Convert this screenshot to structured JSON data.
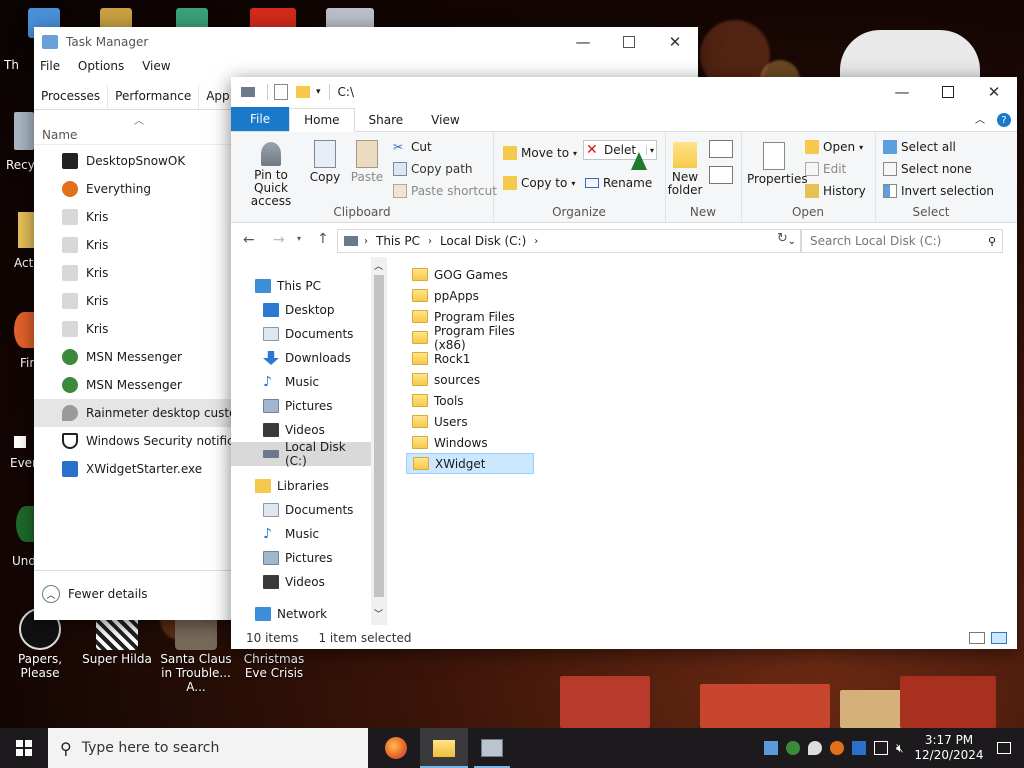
{
  "desktop": {
    "icons": [
      {
        "label": "Th"
      },
      {
        "label": "Recy"
      },
      {
        "label": "Act"
      },
      {
        "label": "Fir"
      },
      {
        "label": "Ever"
      },
      {
        "label": "Und"
      },
      {
        "label": "Papers, Please"
      },
      {
        "label": "Super Hilda"
      },
      {
        "label": "Santa Claus in Trouble... A..."
      },
      {
        "label": "Christmas Eve Crisis"
      }
    ]
  },
  "task_manager": {
    "title": "Task Manager",
    "menu": [
      "File",
      "Options",
      "View"
    ],
    "tabs": [
      "Processes",
      "Performance",
      "App histo"
    ],
    "column_name": "Name",
    "rows": [
      {
        "name": "DesktopSnowOK",
        "icon": "snowflake-icon",
        "color": "#222222"
      },
      {
        "name": "Everything",
        "icon": "magnifier-icon",
        "color": "#e0701a"
      },
      {
        "name": "Kris",
        "icon": "app-icon",
        "color": "#d8d8d8"
      },
      {
        "name": "Kris",
        "icon": "app-icon",
        "color": "#d8d8d8"
      },
      {
        "name": "Kris",
        "icon": "app-icon",
        "color": "#d8d8d8"
      },
      {
        "name": "Kris",
        "icon": "app-icon",
        "color": "#d8d8d8"
      },
      {
        "name": "Kris",
        "icon": "app-icon",
        "color": "#d8d8d8"
      },
      {
        "name": "MSN Messenger",
        "icon": "msn-icon",
        "color": "#3b8a3b"
      },
      {
        "name": "MSN Messenger",
        "icon": "msn-icon",
        "color": "#3b8a3b"
      },
      {
        "name": "Rainmeter desktop customi",
        "icon": "drop-icon",
        "color": "#7a7a7a"
      },
      {
        "name": "Windows Security notificati",
        "icon": "shield-icon",
        "color": "#222222"
      },
      {
        "name": "XWidgetStarter.exe",
        "icon": "xwidget-icon",
        "color": "#2a6fc9"
      }
    ],
    "fewer_details": "Fewer details"
  },
  "explorer": {
    "title": "C:\\",
    "ribbon_tabs": [
      "File",
      "Home",
      "Share",
      "View"
    ],
    "clipboard": {
      "pin": "Pin to Quick access",
      "copy": "Copy",
      "paste": "Paste",
      "cut": "Cut",
      "copy_path": "Copy path",
      "paste_shortcut": "Paste shortcut",
      "label": "Clipboard"
    },
    "organize": {
      "move_to": "Move to",
      "copy_to": "Copy to",
      "delete": "Delet",
      "rename": "Rename",
      "label": "Organize"
    },
    "new": {
      "new_folder": "New folder",
      "label": "New"
    },
    "open": {
      "properties": "Properties",
      "open": "Open",
      "edit": "Edit",
      "history": "History",
      "label": "Open"
    },
    "select": {
      "select_all": "Select all",
      "select_none": "Select none",
      "invert": "Invert selection",
      "label": "Select"
    },
    "address": {
      "this_pc": "This PC",
      "local_disk": "Local Disk (C:)"
    },
    "search_placeholder": "Search Local Disk (C:)",
    "nav": {
      "this_pc": "This PC",
      "pc_items": [
        "Desktop",
        "Documents",
        "Downloads",
        "Music",
        "Pictures",
        "Videos",
        "Local Disk (C:)"
      ],
      "libraries": "Libraries",
      "lib_items": [
        "Documents",
        "Music",
        "Pictures",
        "Videos"
      ],
      "network": "Network"
    },
    "files": [
      "GOG Games",
      "ppApps",
      "Program Files",
      "Program Files (x86)",
      "Rock1",
      "sources",
      "Tools",
      "Users",
      "Windows",
      "XWidget"
    ],
    "status": {
      "items": "10 items",
      "selected": "1 item selected"
    }
  },
  "taskbar": {
    "search_placeholder": "Type here to search",
    "time": "3:17 PM",
    "date": "12/20/2024"
  },
  "colors": {
    "accent": "#1979ca",
    "selection": "#cce8ff",
    "taskbar": "#1c1a1d"
  }
}
